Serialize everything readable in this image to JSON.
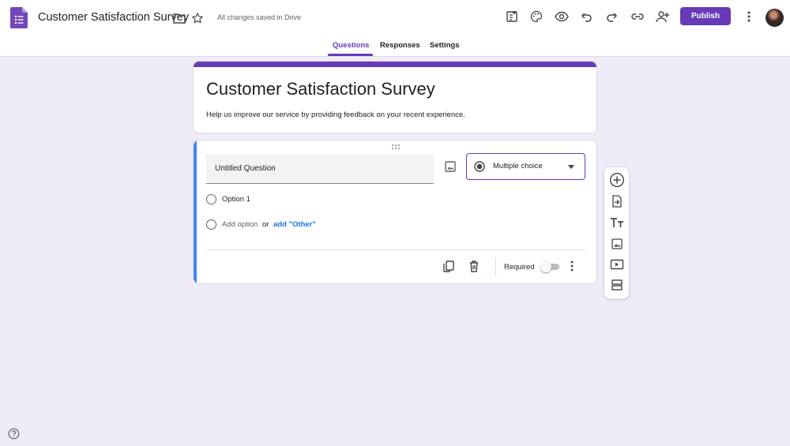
{
  "header": {
    "doc_title": "Customer Satisfaction Survey",
    "save_status": "All changes saved in Drive",
    "publish_label": "Publish",
    "icons": [
      "forms-app-icon",
      "folder-icon",
      "star-icon",
      "add-ons-icon",
      "palette-icon",
      "preview-eye-icon",
      "undo-icon",
      "redo-icon",
      "link-icon",
      "add-collaborator-icon",
      "more-vert-icon"
    ]
  },
  "tabs": [
    {
      "label": "Questions",
      "active": true
    },
    {
      "label": "Responses",
      "active": false
    },
    {
      "label": "Settings",
      "active": false
    }
  ],
  "form": {
    "title": "Customer Satisfaction Survey",
    "description": "Help us improve our service by providing feedback on your recent experience."
  },
  "question": {
    "title": "Untitled Question",
    "type": "Multiple choice",
    "options": [
      "Option 1"
    ],
    "add_option": "Add option",
    "or_word": "or",
    "add_other": "add \"Other\"",
    "required_label": "Required",
    "required": false
  },
  "floating_toolbar": [
    "add-question-icon",
    "import-questions-icon",
    "add-title-icon",
    "add-image-icon",
    "add-video-icon",
    "add-section-icon"
  ],
  "colors": {
    "accent": "#673ab7",
    "background": "#efebf8",
    "link": "#1a73e8",
    "focus_bar": "#4285f4"
  }
}
